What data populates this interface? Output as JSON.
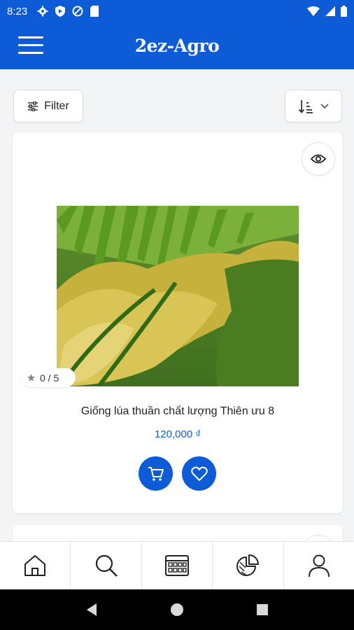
{
  "status_bar": {
    "time": "8:23"
  },
  "app_bar": {
    "title": "2ez-Agro"
  },
  "toolbar": {
    "filter_label": "Filter"
  },
  "product": {
    "name": "Giống lúa thuần chất lượng Thiên ưu 8",
    "price": "120,000 ₫",
    "rating": "0 / 5"
  },
  "bottom_nav": {
    "items": [
      "home-icon",
      "search-icon",
      "calendar-grid-icon",
      "pie-chart-icon",
      "user-icon"
    ]
  },
  "colors": {
    "primary": "#0d5bd7",
    "background": "#f3f4f6"
  }
}
